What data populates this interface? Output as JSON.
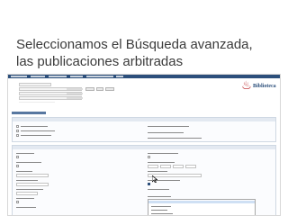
{
  "slide": {
    "title_line1": "Seleccionamos el Búsqueda avanzada,",
    "title_line2": "las publicaciones arbitradas"
  },
  "screenshot": {
    "brand_label": "Biblioteca",
    "brand_icon": "flame-icon",
    "colors": {
      "nav_bar": "#2c4f7b",
      "accent": "#b81e22",
      "panel_header": "#e3e9f1",
      "highlight": "#cfe0f4"
    },
    "peer_reviewed_checkbox": "checked"
  }
}
